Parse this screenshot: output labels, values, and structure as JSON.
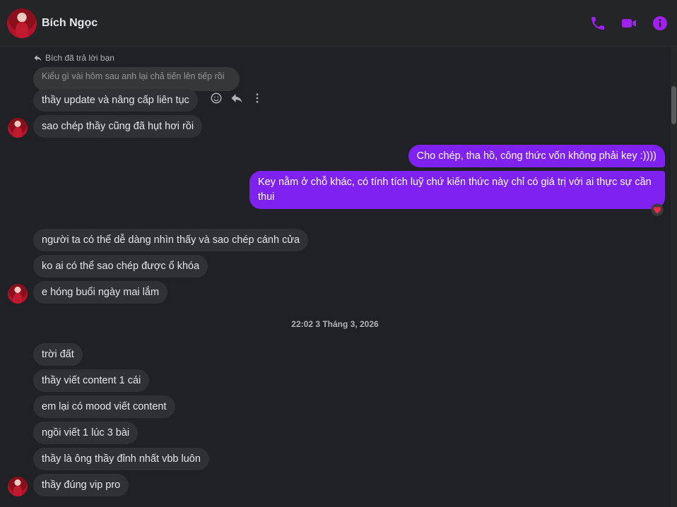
{
  "header": {
    "contact_name": "Bích Ngọc",
    "icons": [
      "phone-icon",
      "video-camera-icon",
      "info-icon"
    ],
    "accent_color": "#a020f0"
  },
  "thread": {
    "reply_note": "Bích đã trả lời bạn",
    "quoted_message": "Kiểu gì vài hôm sau anh lại chả tiến lên tiếp rồi",
    "messages_group1": [
      "thầy update và nâng cấp liên tục",
      "sao chép thầy cũng đã hụt hơi rồi"
    ],
    "outgoing": [
      "Cho chép, tha hồ, công thức vốn không phải key :))))",
      "Key nằm ở chỗ khác, có tính tích luỹ chứ kiến thức này chỉ có giá trị với ai thực sự cần thui"
    ],
    "reaction": "heart",
    "messages_group2": [
      "người ta có thể dễ dàng nhìn thấy và sao chép cánh cửa",
      "ko ai có thể sao chép được ổ khóa",
      "e hóng buổi ngày mai lắm"
    ],
    "timestamp": "22:02 3 Tháng 3, 2026",
    "messages_group3": [
      "trời đất",
      "thầy viết content 1 cái",
      "em lại có mood viết content",
      "ngồi viết 1 lúc 3 bài",
      "thầy là ông thầy đỉnh nhất vbb luôn",
      "thầy đúng vip pro"
    ]
  }
}
